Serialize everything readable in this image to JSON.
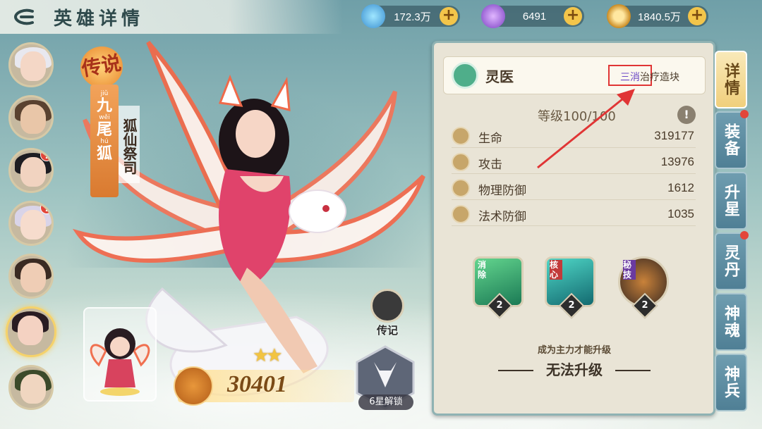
{
  "header": {
    "title": "英雄详情",
    "back_icon": "back-arrow-icon"
  },
  "resources": [
    {
      "name": "crystal",
      "icon": "crystal-icon",
      "value": "172.3万"
    },
    {
      "name": "orb",
      "icon": "purple-orb-icon",
      "value": "6491"
    },
    {
      "name": "coin",
      "icon": "copper-coin-icon",
      "value": "1840.5万"
    }
  ],
  "hero_list": [
    {
      "name": "hero-white-hair",
      "badge": ""
    },
    {
      "name": "hero-masked",
      "badge": ""
    },
    {
      "name": "hero-black-hat",
      "badge": "!"
    },
    {
      "name": "hero-silver-twin",
      "badge": "!"
    },
    {
      "name": "hero-brown-hair",
      "badge": ""
    },
    {
      "name": "hero-nine-tail-fox",
      "badge": "",
      "selected": true
    },
    {
      "name": "hero-green-hat",
      "badge": ""
    }
  ],
  "hero": {
    "rarity": "传说",
    "name_chars": [
      "九",
      "尾",
      "狐"
    ],
    "name_pinyin": [
      "jiǔ",
      "wěi",
      "hú"
    ],
    "title": "狐仙祭司",
    "stars": 2,
    "power": "30401",
    "biography_label": "传记",
    "unlock_label": "6星解锁"
  },
  "panel": {
    "class_name": "灵医",
    "tag_highlight": "三消",
    "tag_rest": "治疗造块",
    "level_text": "等级100/100",
    "stats": [
      {
        "label": "生命",
        "value": "319177",
        "icon": "heart-icon"
      },
      {
        "label": "攻击",
        "value": "13976",
        "icon": "sword-icon"
      },
      {
        "label": "物理防御",
        "value": "1612",
        "icon": "shield-icon"
      },
      {
        "label": "法术防御",
        "value": "1035",
        "icon": "magic-shield-icon"
      }
    ],
    "skills": [
      {
        "tag": "消除",
        "level": "2",
        "color": "#2c9a6a"
      },
      {
        "tag": "核心",
        "level": "2",
        "color": "#1f8a8f"
      },
      {
        "tag": "秘技",
        "level": "2",
        "color": "#3a2a22"
      }
    ],
    "upgrade_hint": "成为主力才能升级",
    "upgrade_label": "无法升级"
  },
  "tabs": [
    {
      "label": "详情",
      "active": true,
      "dot": false
    },
    {
      "label": "装备",
      "active": false,
      "dot": true
    },
    {
      "label": "升星",
      "active": false,
      "dot": false
    },
    {
      "label": "灵丹",
      "active": false,
      "dot": true
    },
    {
      "label": "神魂",
      "active": false,
      "dot": false
    },
    {
      "label": "神兵",
      "active": false,
      "dot": false
    }
  ]
}
